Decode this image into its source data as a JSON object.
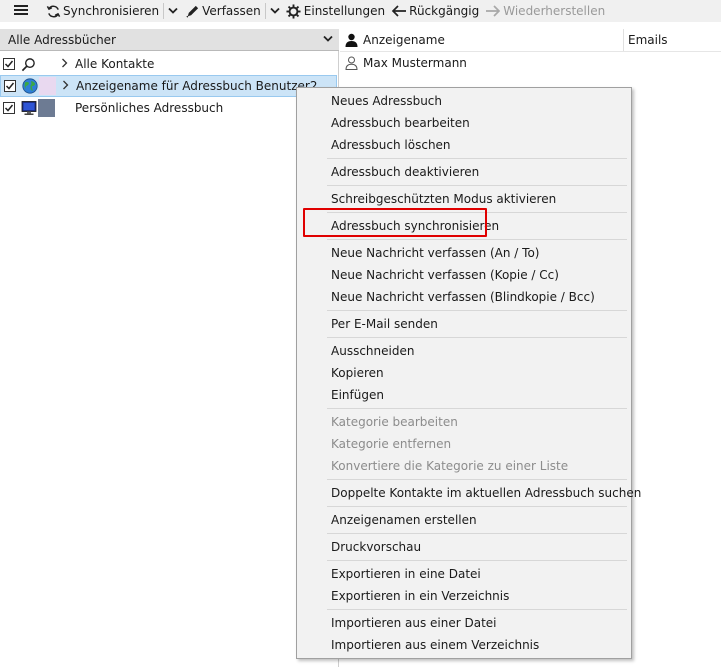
{
  "toolbar": {
    "menu_icon": "hamburger-icon",
    "sync_label": "Synchronisieren",
    "compose_label": "Verfassen",
    "settings_label": "Einstellungen",
    "undo_label": "Rückgängig",
    "redo_label": "Wiederherstellen"
  },
  "left": {
    "dropdown_label": "Alle Adressbücher",
    "items": [
      {
        "label": "Alle Kontakte",
        "icon": "search-icon",
        "checked": true
      },
      {
        "label": "Anzeigename für Adressbuch Benutzer2",
        "icon": "globe-icon",
        "checked": true,
        "swatch": "#e9d9f0",
        "selected": true
      },
      {
        "label": "Persönliches Adressbuch",
        "icon": "computer-icon",
        "checked": true,
        "swatch": "#6d7b93"
      }
    ]
  },
  "right": {
    "columns": [
      "Anzeigename",
      "Emails"
    ],
    "contacts": [
      {
        "name": "Max Mustermann"
      }
    ]
  },
  "context_menu": {
    "items": [
      "Neues Adressbuch",
      "Adressbuch bearbeiten",
      "Adressbuch löschen",
      "Adressbuch deaktivieren",
      "Schreibgeschützten Modus aktivieren",
      "Adressbuch synchronisieren",
      "Neue Nachricht verfassen (An / To)",
      "Neue Nachricht verfassen (Kopie / Cc)",
      "Neue Nachricht verfassen (Blindkopie / Bcc)",
      "Per E-Mail senden",
      "Ausschneiden",
      "Kopieren",
      "Einfügen",
      "Kategorie bearbeiten",
      "Kategorie entfernen",
      "Konvertiere die Kategorie zu einer Liste",
      "Doppelte Kontakte im aktuellen Adressbuch suchen",
      "Anzeigenamen erstellen",
      "Druckvorschau",
      "Exportieren in eine Datei",
      "Exportieren in ein Verzeichnis",
      "Importieren aus einer Datei",
      "Importieren aus einem Verzeichnis"
    ],
    "disabled": [
      "Kategorie bearbeiten",
      "Kategorie entfernen",
      "Konvertiere die Kategorie zu einer Liste"
    ],
    "highlighted": "Adressbuch synchronisieren",
    "highlight_color": "#e00000"
  },
  "colors": {
    "selection": "#cce4f7",
    "toolbar_bg": "#f0f0f0",
    "menu_bg": "#f2f2f2"
  }
}
